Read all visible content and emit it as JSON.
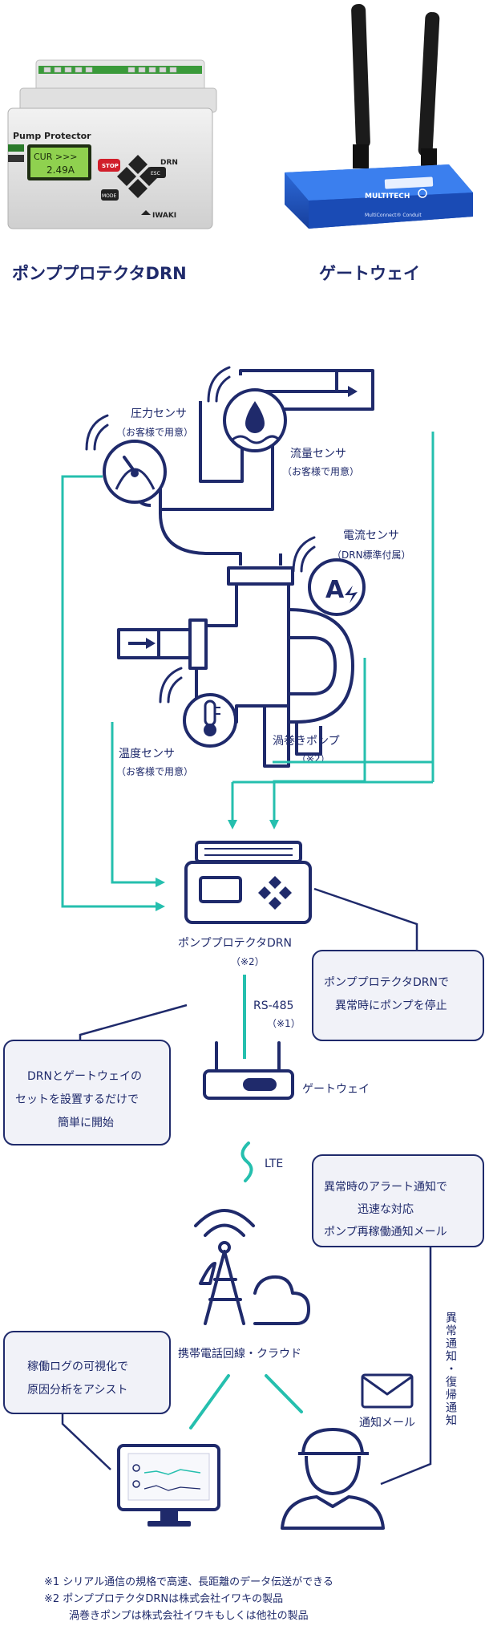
{
  "products": {
    "drn_title": "ポンププロテクタDRN",
    "gateway_title": "ゲートウェイ",
    "drn_device_brand": "Pump Protector",
    "drn_device_model": "DRN",
    "drn_lcd_line1": "CUR >>>",
    "drn_lcd_line2": "2.49A",
    "drn_key_stop": "STOP",
    "drn_key_esc": "ESC",
    "drn_key_mode": "MODE",
    "drn_maker": "IWAKI",
    "gateway_brand": "MULTITECH",
    "gateway_model": "MultiConnect® Conduit"
  },
  "sensors": {
    "pressure": "圧力センサ",
    "pressure_note": "（お客様で用意）",
    "flow": "流量センサ",
    "flow_note": "（お客様で用意）",
    "current": "電流センサ",
    "current_note": "（DRN標準付属）",
    "temperature": "温度センサ",
    "temperature_note": "（お客様で用意）",
    "pump": "渦巻きポンプ",
    "pump_note": "（※2）"
  },
  "system": {
    "drn_label": "ポンププロテクタDRN",
    "drn_note": "（※2）",
    "rs485": "RS-485",
    "rs485_note": "（※1）",
    "gateway_label": "ゲートウェイ",
    "lte": "LTE",
    "cloud_label": "携帯電話回線・クラウド",
    "mail_label": "通知メール",
    "notify_vertical": "異常通知・復帰通知"
  },
  "callouts": {
    "stop_line1": "ポンププロテクタDRNで",
    "stop_line2": "異常時にポンプを停止",
    "setup_line1": "DRNとゲートウェイの",
    "setup_line2": "セットを設置するだけで",
    "setup_line3": "簡単に開始",
    "alert_line1": "異常時のアラート通知で",
    "alert_line2": "迅速な対応",
    "alert_line3": "ポンプ再稼働通知メール",
    "log_line1": "稼働ログの可視化で",
    "log_line2": "原因分析をアシスト"
  },
  "footnotes": {
    "note1": "※1 シリアル通信の規格で高速、長距離のデータ伝送ができる",
    "note2": "※2 ポンププロテクタDRNは株式会社イワキの製品",
    "note3": "渦巻きポンプは株式会社イワキもしくは他社の製品"
  },
  "colors": {
    "navy": "#1f2a6b",
    "teal": "#25bfae",
    "callout_bg": "#f1f2f8",
    "gateway_blue": "#1d56c8"
  }
}
